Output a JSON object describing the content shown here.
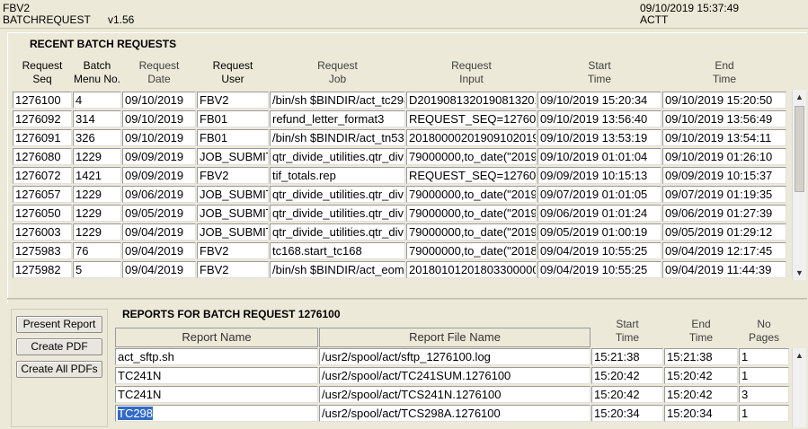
{
  "header": {
    "app_id": "FBV2",
    "form_id": "BATCHREQUEST",
    "version": "v1.56",
    "datetime": "09/10/2019 15:37:49",
    "environment": "ACTT"
  },
  "recent": {
    "title": "RECENT BATCH REQUESTS",
    "headers": {
      "seq": [
        "Request",
        "Seq"
      ],
      "menu": [
        "Batch",
        "Menu No."
      ],
      "date": [
        "Request",
        "Date"
      ],
      "user": [
        "Request",
        "User"
      ],
      "job": [
        "Request",
        "Job"
      ],
      "input": [
        "Request",
        "Input"
      ],
      "start": [
        "Start",
        "Time"
      ],
      "end": [
        "End",
        "Time"
      ]
    },
    "rows": [
      [
        "1276100",
        "4",
        "09/10/2019",
        "FBV2",
        "/bin/sh $BINDIR/act_tc298",
        "D20190813201908132019",
        "09/10/2019 15:20:34",
        "09/10/2019 15:20:50"
      ],
      [
        "1276092",
        "314",
        "09/10/2019",
        "FB01",
        "refund_letter_format3",
        "REQUEST_SEQ=1276092",
        "09/10/2019 13:56:40",
        "09/10/2019 13:56:49"
      ],
      [
        "1276091",
        "326",
        "09/10/2019",
        "FB01",
        "/bin/sh $BINDIR/act_tn53",
        "20180000201909102019",
        "09/10/2019 13:53:19",
        "09/10/2019 13:54:11"
      ],
      [
        "1276080",
        "1229",
        "09/09/2019",
        "JOB_SUBMIT",
        "qtr_divide_utilities.qtr_div",
        "79000000,to_date(\"2019",
        "09/10/2019 01:01:04",
        "09/10/2019 01:26:10"
      ],
      [
        "1276072",
        "1421",
        "09/09/2019",
        "FBV2",
        "tif_totals.rep",
        "REQUEST_SEQ=1276072",
        "09/09/2019 10:15:13",
        "09/09/2019 10:15:37"
      ],
      [
        "1276057",
        "1229",
        "09/06/2019",
        "JOB_SUBMIT",
        "qtr_divide_utilities.qtr_div",
        "79000000,to_date(\"2019",
        "09/07/2019 01:01:05",
        "09/07/2019 01:19:35"
      ],
      [
        "1276050",
        "1229",
        "09/05/2019",
        "JOB_SUBMIT",
        "qtr_divide_utilities.qtr_div",
        "79000000,to_date(\"2019",
        "09/06/2019 01:01:24",
        "09/06/2019 01:27:39"
      ],
      [
        "1276003",
        "1229",
        "09/04/2019",
        "JOB_SUBMIT",
        "qtr_divide_utilities.qtr_div",
        "79000000,to_date(\"2019",
        "09/05/2019 01:00:19",
        "09/05/2019 01:29:12"
      ],
      [
        "1275983",
        "76",
        "09/04/2019",
        "FBV2",
        "tc168.start_tc168",
        "79000000,to_date(\"2018",
        "09/04/2019 10:55:25",
        "09/04/2019 12:17:45"
      ],
      [
        "1275982",
        "5",
        "09/04/2019",
        "FBV2",
        "/bin/sh $BINDIR/act_eom",
        "20180101201803300000",
        "09/04/2019 10:55:25",
        "09/04/2019 11:44:39"
      ]
    ]
  },
  "buttons": {
    "present_report": "Present Report",
    "create_pdf": "Create PDF",
    "create_all_pdfs": "Create All PDFs"
  },
  "reports": {
    "title": "REPORTS FOR BATCH REQUEST 1276100",
    "headers": {
      "name": "Report Name",
      "file": "Report File Name",
      "start": [
        "Start",
        "Time"
      ],
      "end": [
        "End",
        "Time"
      ],
      "pages": [
        "No",
        "Pages"
      ]
    },
    "rows": [
      [
        "act_sftp.sh",
        "/usr2/spool/act/sftp_1276100.log",
        "15:21:38",
        "15:21:38",
        "1"
      ],
      [
        "TC241N",
        "/usr2/spool/act/TC241SUM.1276100",
        "15:20:42",
        "15:20:42",
        "1"
      ],
      [
        "TC241N",
        "/usr2/spool/act/TCS241N.1276100",
        "15:20:42",
        "15:20:42",
        "3"
      ],
      [
        "TC298",
        "/usr2/spool/act/TCS298A.1276100",
        "15:20:34",
        "15:20:34",
        "1"
      ]
    ],
    "selected_row": 3
  },
  "icons": {
    "scroll_up": "scroll-up-arrow-icon",
    "scroll_down": "scroll-down-arrow-icon"
  }
}
